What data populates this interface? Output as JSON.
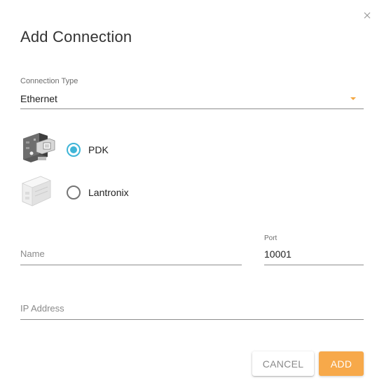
{
  "dialog": {
    "title": "Add Connection",
    "close_icon": "close-icon"
  },
  "connection_type": {
    "label": "Connection Type",
    "value": "Ethernet",
    "arrow_icon": "dropdown-arrow-icon"
  },
  "devices": [
    {
      "label": "PDK",
      "selected": true,
      "image": "pdk-device-image"
    },
    {
      "label": "Lantronix",
      "selected": false,
      "image": "lantronix-device-image"
    }
  ],
  "fields": {
    "name": {
      "placeholder": "Name",
      "value": ""
    },
    "port": {
      "label": "Port",
      "value": "10001"
    },
    "ip_address": {
      "placeholder": "IP Address",
      "value": ""
    }
  },
  "buttons": {
    "cancel": "CANCEL",
    "add": "ADD"
  },
  "colors": {
    "accent": "#f7a94a",
    "radio_selected": "#3fb5d7",
    "dropdown_arrow": "#f4a63f"
  }
}
